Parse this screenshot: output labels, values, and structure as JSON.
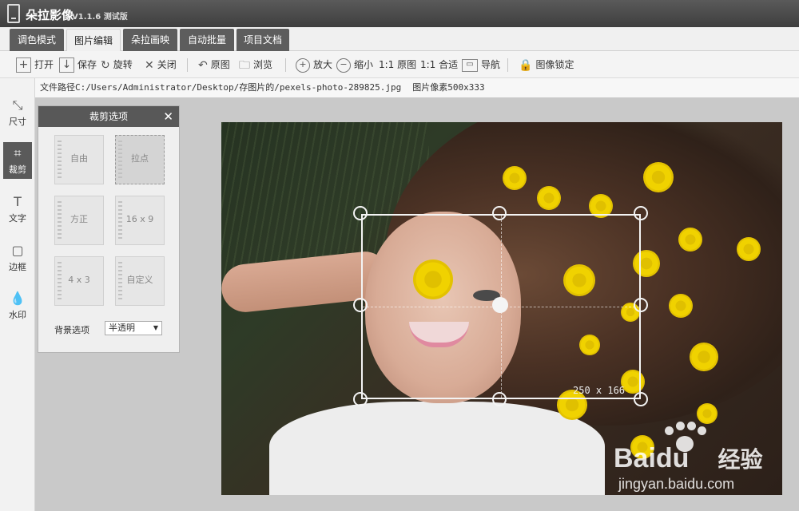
{
  "app": {
    "title": "朵拉影像",
    "version": "V1.1.6 测试版"
  },
  "tabs": [
    {
      "label": "调色模式",
      "active": false
    },
    {
      "label": "图片编辑",
      "active": true
    },
    {
      "label": "朵拉画映",
      "active": false
    },
    {
      "label": "自动批量",
      "active": false
    },
    {
      "label": "项目文档",
      "active": false
    }
  ],
  "toolbar": {
    "open": "打开",
    "save": "保存",
    "rotate": "旋转",
    "close": "关闭",
    "original": "原图",
    "browse": "浏览",
    "zoom_in": "放大",
    "zoom_out": "缩小",
    "ratio_orig": "1:1 原图",
    "ratio_fit": "1:1 合适",
    "navigate": "导航",
    "lock": "图像锁定"
  },
  "pathbar": {
    "path": "文件路径C:/Users/Administrator/Desktop/存图片的/pexels-photo-289825.jpg",
    "pixels": "图片像素500x333"
  },
  "sidebar": [
    {
      "label": "尺寸",
      "icon": "resize-icon",
      "active": false
    },
    {
      "label": "裁剪",
      "icon": "crop-icon",
      "active": true
    },
    {
      "label": "文字",
      "icon": "text-icon",
      "active": false
    },
    {
      "label": "边框",
      "icon": "border-icon",
      "active": false
    },
    {
      "label": "水印",
      "icon": "watermark-icon",
      "active": false
    }
  ],
  "crop_panel": {
    "title": "裁剪选项",
    "options": [
      {
        "label": "自由",
        "active": false
      },
      {
        "label": "拉点",
        "active": true
      },
      {
        "label": "方正",
        "active": false
      },
      {
        "label": "16 x 9",
        "active": false
      },
      {
        "label": "4 x 3",
        "active": false
      },
      {
        "label": "自定义",
        "active": false
      }
    ],
    "bg_label": "背景选项",
    "bg_value": "半透明"
  },
  "crop_box": {
    "size_text": "250 x 166"
  },
  "watermark": {
    "brand": "Baidu",
    "brand_cn": "经验",
    "url": "jingyan.baidu.com"
  },
  "colors": {
    "titlebar": "#4a4a4a",
    "tab_dark": "#5d5d5d",
    "workspace": "#c9c9c9",
    "panel_header": "#585858"
  }
}
